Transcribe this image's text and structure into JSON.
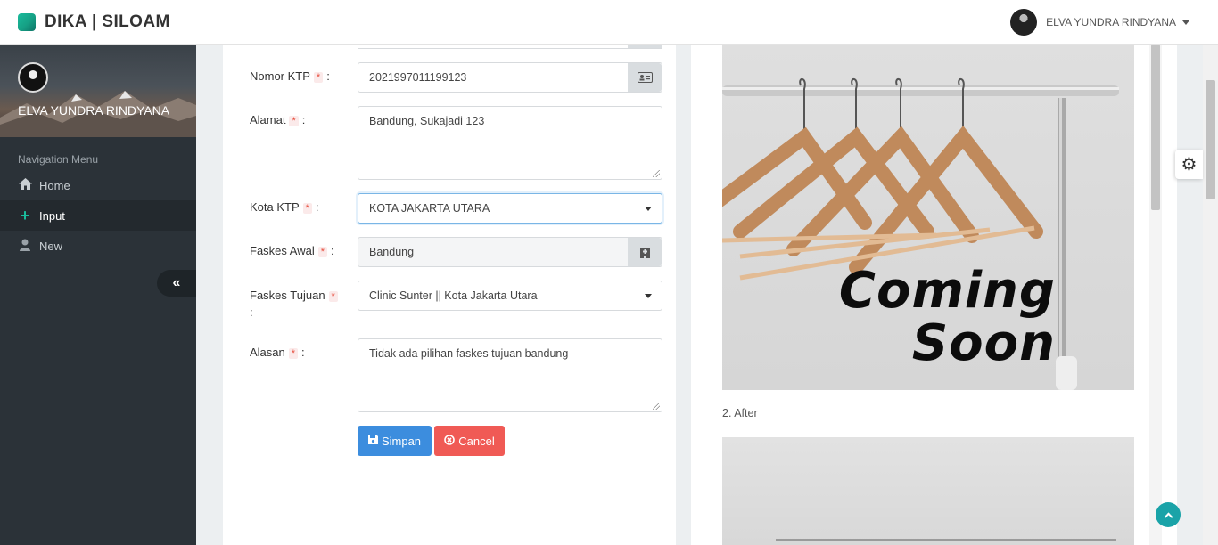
{
  "app": {
    "brand": "DIKA | SILOAM"
  },
  "user": {
    "name": "ELVA YUNDRA RINDYANA"
  },
  "sidebar": {
    "profile_name": "ELVA YUNDRA RINDYANA",
    "nav_title": "Navigation Menu",
    "items": [
      {
        "label": "Home",
        "icon": "home-icon",
        "active": false
      },
      {
        "label": "Input",
        "icon": "plus-icon",
        "active": true
      },
      {
        "label": "New",
        "icon": "user-icon",
        "active": false
      }
    ],
    "collapse_icon": "double-chevron-left-icon"
  },
  "form": {
    "colon": ":",
    "required_mark": "*",
    "nomor_ktp": {
      "label": "Nomor KTP",
      "value": "2021997011199123",
      "icon": "id-card-icon"
    },
    "alamat": {
      "label": "Alamat",
      "value": "Bandung, Sukajadi 123"
    },
    "kota_ktp": {
      "label": "Kota KTP",
      "value": "KOTA JAKARTA UTARA"
    },
    "faskes_awal": {
      "label": "Faskes Awal",
      "value": "Bandung",
      "icon": "hospital-icon"
    },
    "faskes_tujuan": {
      "label": "Faskes Tujuan",
      "value": "Clinic Sunter || Kota Jakarta Utara"
    },
    "alasan": {
      "label": "Alasan",
      "value": "Tidak ada pilihan faskes tujuan bandung"
    },
    "save_label": "Simpan",
    "cancel_label": "Cancel"
  },
  "preview": {
    "image_text_line1": "Coming",
    "image_text_line2": "Soon",
    "after_label": "2. After"
  },
  "colors": {
    "accent": "#1abc9c",
    "primary": "#3c8dde",
    "danger": "#f05a55",
    "sidebar": "#2b3238"
  }
}
